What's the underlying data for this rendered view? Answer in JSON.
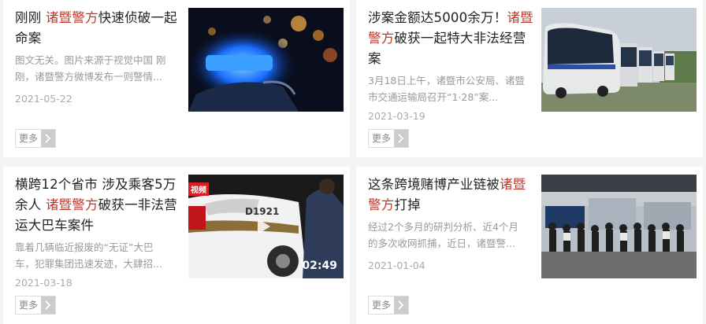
{
  "articles": [
    {
      "title_parts": [
        "刚刚 ",
        "诸暨警方",
        "快速侦破一起命案"
      ],
      "summary": "图文无关。图片来源于视觉中国 刚刚，诸暨警方微博发布一则警情...",
      "date": "2021-05-22",
      "more_label": "更多",
      "thumb_icon": "police-light-photo"
    },
    {
      "title_parts": [
        "涉案金额达5000余万！",
        "诸暨警方",
        "破获一起特大非法经营案"
      ],
      "summary": "3月18日上午，诸暨市公安局、诸暨市交通运输局召开“1·28”案...",
      "date": "2021-03-19",
      "more_label": "更多",
      "thumb_icon": "buses-photo"
    },
    {
      "title_parts": [
        "横跨12个省市 涉及乘客5万余人 ",
        "诸暨警方",
        "破获一非法营运大巴车案件"
      ],
      "summary": "靠着几辆临近报废的“无证”大巴车，犯罪集团迅速发迹，大肆招...",
      "date": "2021-03-18",
      "more_label": "更多",
      "thumb_icon": "police-car-video",
      "video_badge": "视频",
      "plate_text": "D1921",
      "video_duration": "02:49"
    },
    {
      "title_parts": [
        "这条跨境赌博产业链被",
        "诸暨警方",
        "打掉"
      ],
      "summary": "经过2个多月的研判分析、近4个月的多次收网抓捕，近日，诸暨警...",
      "date": "2021-01-04",
      "more_label": "更多",
      "thumb_icon": "suspects-group-photo"
    }
  ],
  "colors": {
    "highlight": "#c0392b",
    "title": "#222222",
    "muted": "#999999"
  }
}
